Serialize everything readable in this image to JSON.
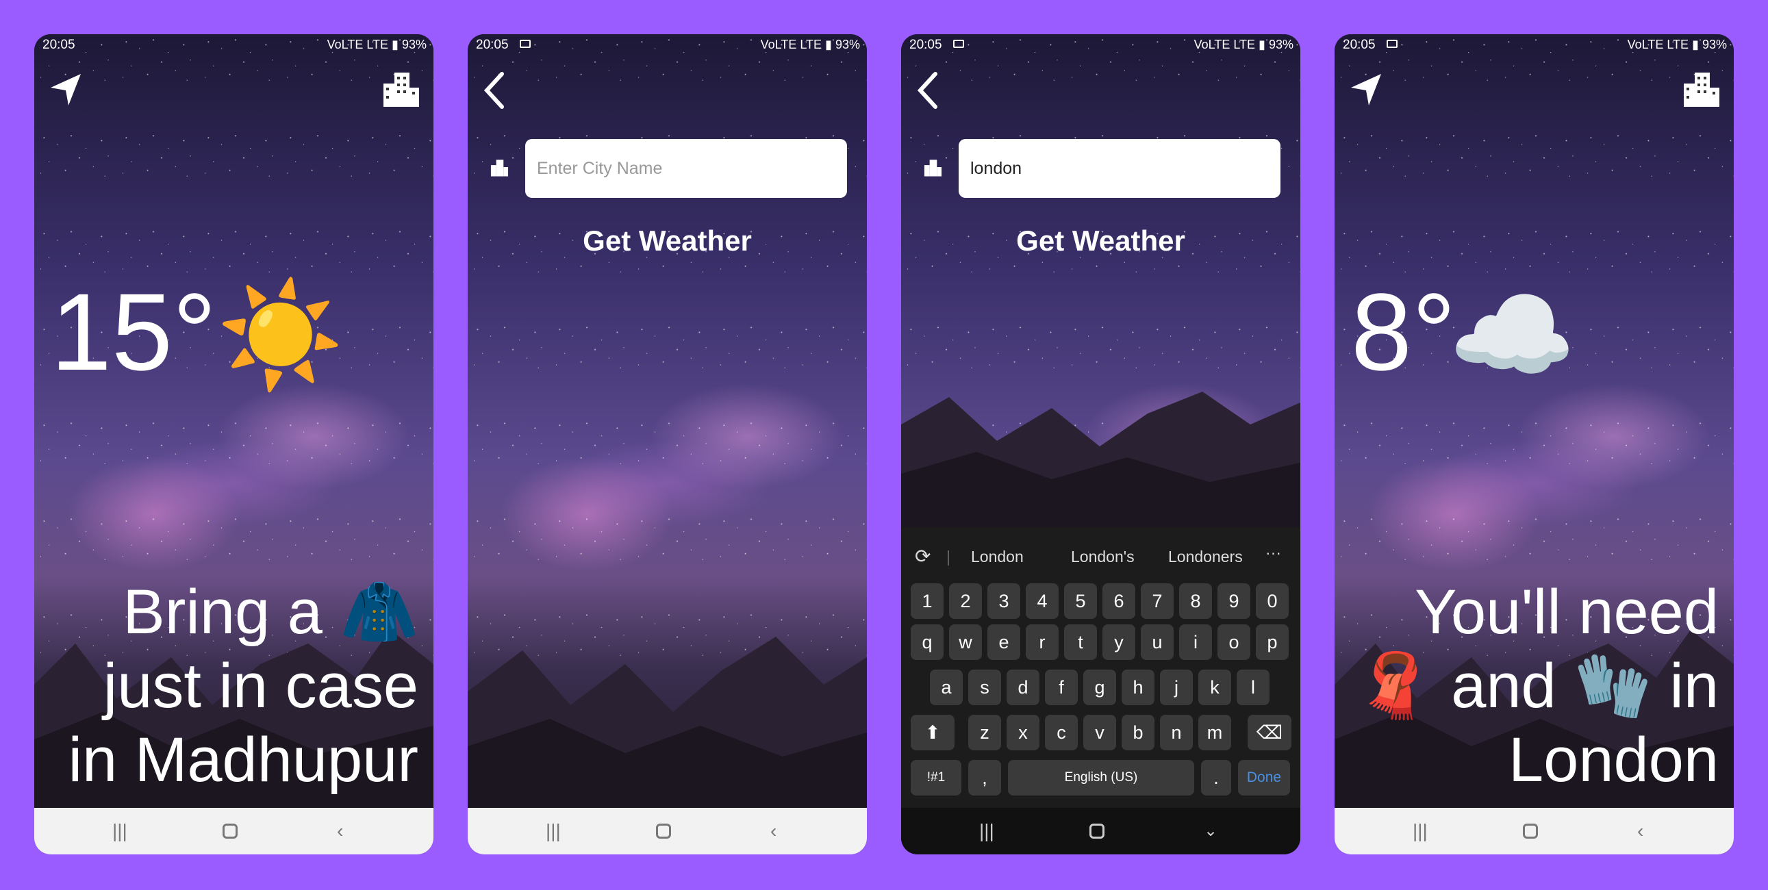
{
  "status": {
    "time": "20:05",
    "battery": "93%",
    "network": "VoLTE LTE"
  },
  "screen1": {
    "temperature": "15°",
    "weather_icon": "☀️",
    "message": "Bring a 🧥 just in case in Madhupur"
  },
  "screen2": {
    "city_placeholder": "Enter City Name",
    "get_weather_label": "Get Weather"
  },
  "screen3": {
    "city_value": "london",
    "get_weather_label": "Get Weather",
    "keyboard": {
      "suggestions": [
        "London",
        "London's",
        "Londoners"
      ],
      "row_numbers": [
        "1",
        "2",
        "3",
        "4",
        "5",
        "6",
        "7",
        "8",
        "9",
        "0"
      ],
      "row1": [
        "q",
        "w",
        "e",
        "r",
        "t",
        "y",
        "u",
        "i",
        "o",
        "p"
      ],
      "row2": [
        "a",
        "s",
        "d",
        "f",
        "g",
        "h",
        "j",
        "k",
        "l"
      ],
      "row3": [
        "z",
        "x",
        "c",
        "v",
        "b",
        "n",
        "m"
      ],
      "symbols_label": "!#1",
      "comma_label": ",",
      "space_label": "English (US)",
      "period_label": ".",
      "done_label": "Done"
    }
  },
  "screen4": {
    "temperature": "8°",
    "weather_icon": "☁️",
    "message": "You'll need 🧣 and 🧤 in London"
  },
  "icons": {
    "location": "location-arrow-icon",
    "city": "city-buildings-icon",
    "back": "back-arrow-icon"
  },
  "colors": {
    "page_bg": "#9b5cff",
    "accent_done": "#4a90e2"
  }
}
